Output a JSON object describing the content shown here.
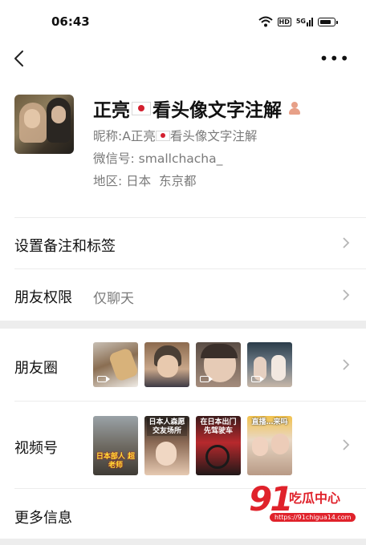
{
  "status_bar": {
    "time": "06:43",
    "hd_badge": "HD",
    "signal_label": "5G"
  },
  "profile": {
    "name": "正亮",
    "name_suffix": "看头像文字注解",
    "nickname_label": "昵称: ",
    "nickname_prefix": "A正亮",
    "nickname_suffix": "看头像文字注解",
    "wechat_id_label": "微信号: ",
    "wechat_id": "smallchacha_",
    "region_label": "地区: ",
    "region": "日本  东京都",
    "flag_icon": "japan-flag",
    "gender_icon": "female-icon",
    "gender_color": "#e7a088"
  },
  "list": {
    "remark_label": "设置备注和标签",
    "permission_label": "朋友权限",
    "permission_value": "仅聊天",
    "moments_label": "朋友圈",
    "channels_label": "视频号",
    "more_label": "更多信息"
  },
  "channels_thumbs": [
    {
      "caption": "日本部人 超老师"
    },
    {
      "caption": "日本人森愿 交友场所"
    },
    {
      "caption": "在日本出门 先驾驶车"
    },
    {
      "caption": "直播…来吗"
    }
  ],
  "watermark": {
    "number": "91",
    "text": "吃瓜中心",
    "url": "https://91chigua14.com"
  },
  "colors": {
    "accent_red": "#e0222b",
    "flag_red": "#d3202f",
    "secondary_text": "#7a7a7a"
  }
}
